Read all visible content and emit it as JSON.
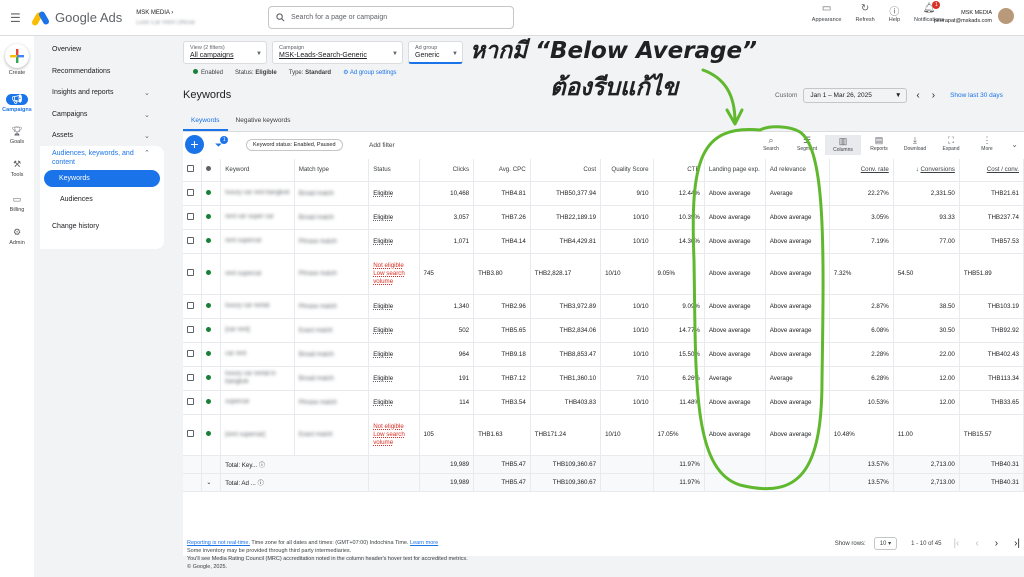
{
  "app": {
    "name": "Google Ads",
    "account_name": "MSK MEDIA",
    "account_sub": "Luxe Car Rent Official"
  },
  "search": {
    "placeholder": "Search for a page or campaign"
  },
  "tools": [
    {
      "label": "Appearance",
      "icon": "appearance-icon"
    },
    {
      "label": "Refresh",
      "icon": "refresh-icon"
    },
    {
      "label": "Help",
      "icon": "help-icon"
    },
    {
      "label": "Notifications",
      "icon": "bell-icon",
      "badge": "1"
    }
  ],
  "user": {
    "org": "MSK MEDIA",
    "email": "peerapat@mskads.com"
  },
  "rail": [
    {
      "label": "Create"
    },
    {
      "label": "Campaigns"
    },
    {
      "label": "Goals"
    },
    {
      "label": "Tools"
    },
    {
      "label": "Billing"
    },
    {
      "label": "Admin"
    }
  ],
  "nav": {
    "overview": "Overview",
    "recommendations": "Recommendations",
    "insights": "Insights and reports",
    "campaigns": "Campaigns",
    "assets": "Assets",
    "audiences_kw": "Audiences, keywords, and content",
    "keywords": "Keywords",
    "audiences": "Audiences",
    "change_history": "Change history"
  },
  "filters": {
    "view_label": "View (2 filters)",
    "view_value": "All campaigns",
    "campaign_label": "Campaign",
    "campaign_value": "MSK-Leads-Search-Generic",
    "adgroup_label": "Ad group",
    "adgroup_value": "Generic"
  },
  "status": {
    "enabled": "Enabled",
    "status": "Status:",
    "status_value": "Eligible",
    "type": "Type:",
    "type_value": "Standard",
    "settings": "Ad group settings"
  },
  "page": {
    "title": "Keywords"
  },
  "date": {
    "custom": "Custom",
    "range": "Jan 1 – Mar 26, 2025",
    "last": "Show last 30 days"
  },
  "tabs": [
    "Keywords",
    "Negative keywords"
  ],
  "toolbar": {
    "filter_badge": "1",
    "chip": "Keyword status: Enabled, Paused",
    "add_filter": "Add filter",
    "search": "Search",
    "segment": "Segment",
    "columns": "Columns",
    "reports": "Reports",
    "download": "Download",
    "expand": "Expand",
    "more": "More"
  },
  "columns": [
    "Keyword",
    "Match type",
    "Status",
    "Clicks",
    "Avg. CPC",
    "Cost",
    "Quality Score",
    "CTR",
    "Landing page exp.",
    "Ad relevance",
    "Conv. rate",
    "Conversions",
    "Cost / conv."
  ],
  "rows": [
    {
      "kw": "luxury car rent bangkok",
      "match": "Broad match",
      "status": "Eligible",
      "clicks": "10,468",
      "cpc": "THB4.81",
      "cost": "THB50,377.94",
      "qs": "9/10",
      "ctr": "12.44%",
      "lp": "Above average",
      "ar": "Average",
      "cr": "22.27%",
      "conv": "2,331.50",
      "cpcv": "THB21.61",
      "tall": false
    },
    {
      "kw": "rent car super car",
      "match": "Broad match",
      "status": "Eligible",
      "clicks": "3,057",
      "cpc": "THB7.26",
      "cost": "THB22,189.19",
      "qs": "10/10",
      "ctr": "10.39%",
      "lp": "Above average",
      "ar": "Above average",
      "cr": "3.05%",
      "conv": "93.33",
      "cpcv": "THB237.74",
      "tall": false
    },
    {
      "kw": "rent supercar",
      "match": "Phrase match",
      "status": "Eligible",
      "clicks": "1,071",
      "cpc": "THB4.14",
      "cost": "THB4,429.81",
      "qs": "10/10",
      "ctr": "14.30%",
      "lp": "Above average",
      "ar": "Above average",
      "cr": "7.19%",
      "conv": "77.00",
      "cpcv": "THB57.53",
      "tall": false
    },
    {
      "kw": "rent supercar",
      "match": "Phrase match",
      "status": "Not eligible\nLow search\nvolume",
      "clicks": "745",
      "cpc": "THB3.80",
      "cost": "THB2,828.17",
      "qs": "10/10",
      "ctr": "9.05%",
      "lp": "Above average",
      "ar": "Above average",
      "cr": "7.32%",
      "conv": "54.50",
      "cpcv": "THB51.89",
      "tall": true
    },
    {
      "kw": "luxury car rental",
      "match": "Phrase match",
      "status": "Eligible",
      "clicks": "1,340",
      "cpc": "THB2.96",
      "cost": "THB3,972.89",
      "qs": "10/10",
      "ctr": "9.09%",
      "lp": "Above average",
      "ar": "Above average",
      "cr": "2.87%",
      "conv": "38.50",
      "cpcv": "THB103.19",
      "tall": false
    },
    {
      "kw": "[car rent]",
      "match": "Exact match",
      "status": "Eligible",
      "clicks": "502",
      "cpc": "THB5.65",
      "cost": "THB2,834.06",
      "qs": "10/10",
      "ctr": "14.77%",
      "lp": "Above average",
      "ar": "Above average",
      "cr": "6.08%",
      "conv": "30.50",
      "cpcv": "THB92.92",
      "tall": false
    },
    {
      "kw": "car rent",
      "match": "Broad match",
      "status": "Eligible",
      "clicks": "964",
      "cpc": "THB9.18",
      "cost": "THB8,853.47",
      "qs": "10/10",
      "ctr": "15.50%",
      "lp": "Above average",
      "ar": "Above average",
      "cr": "2.28%",
      "conv": "22.00",
      "cpcv": "THB402.43",
      "tall": false
    },
    {
      "kw": "luxury car rental in bangkok",
      "match": "Broad match",
      "status": "Eligible",
      "clicks": "191",
      "cpc": "THB7.12",
      "cost": "THB1,360.10",
      "qs": "7/10",
      "ctr": "6.26%",
      "lp": "Average",
      "ar": "Average",
      "cr": "6.28%",
      "conv": "12.00",
      "cpcv": "THB113.34",
      "tall": false
    },
    {
      "kw": "supercar",
      "match": "Phrase match",
      "status": "Eligible",
      "clicks": "114",
      "cpc": "THB3.54",
      "cost": "THB403.83",
      "qs": "10/10",
      "ctr": "11.48%",
      "lp": "Above average",
      "ar": "Above average",
      "cr": "10.53%",
      "conv": "12.00",
      "cpcv": "THB33.65",
      "tall": false
    },
    {
      "kw": "[rent supercar]",
      "match": "Exact match",
      "status": "Not eligible\nLow search\nvolume",
      "clicks": "105",
      "cpc": "THB1.63",
      "cost": "THB171.24",
      "qs": "10/10",
      "ctr": "17.05%",
      "lp": "Above average",
      "ar": "Above average",
      "cr": "10.48%",
      "conv": "11.00",
      "cpcv": "THB15.57",
      "tall": true
    }
  ],
  "totals": [
    {
      "label": "Total: Key...",
      "clicks": "19,989",
      "cpc": "THB5.47",
      "cost": "THB109,360.67",
      "ctr": "11.97%",
      "cr": "13.57%",
      "conv": "2,713.00",
      "cpcv": "THB40.31"
    },
    {
      "label": "Total: Ad ...",
      "clicks": "19,989",
      "cpc": "THB5.47",
      "cost": "THB109,360.67",
      "ctr": "11.97%",
      "cr": "13.57%",
      "conv": "2,713.00",
      "cpcv": "THB40.31"
    }
  ],
  "pager": {
    "show_rows": "Show rows:",
    "rows": "10",
    "range": "1 - 10 of 45"
  },
  "footer": {
    "line1_link": "Reporting is not real-time.",
    "line1": " Time zone for all dates and times: (GMT+07:00) Indochina Time. ",
    "line1_learn": "Learn more",
    "line2": "Some inventory may be provided through third party intermediaries.",
    "line3": "You'll see Media Rating Council (MRC) accreditation noted in the column header's hover text for accredited metrics.",
    "line4": "© Google, 2025."
  },
  "annotation": {
    "line1": "หากมี “Below Average”",
    "line2": "ต้องรีบแก้ไข",
    "color": "#5fb82e"
  }
}
